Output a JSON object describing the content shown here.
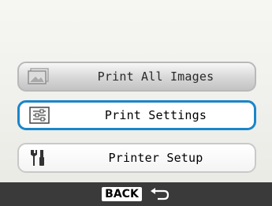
{
  "menu": {
    "items": [
      {
        "label": "Print All Images",
        "icon": "images-icon",
        "state": "disabled"
      },
      {
        "label": "Print Settings",
        "icon": "settings-list-icon",
        "state": "selected"
      },
      {
        "label": "Printer Setup",
        "icon": "tools-icon",
        "state": "normal"
      }
    ]
  },
  "footer": {
    "back_label": "BACK",
    "back_icon": "return-arrow-icon"
  },
  "colors": {
    "selection": "#1a86c9",
    "footer_bg": "#3a3a3a"
  }
}
